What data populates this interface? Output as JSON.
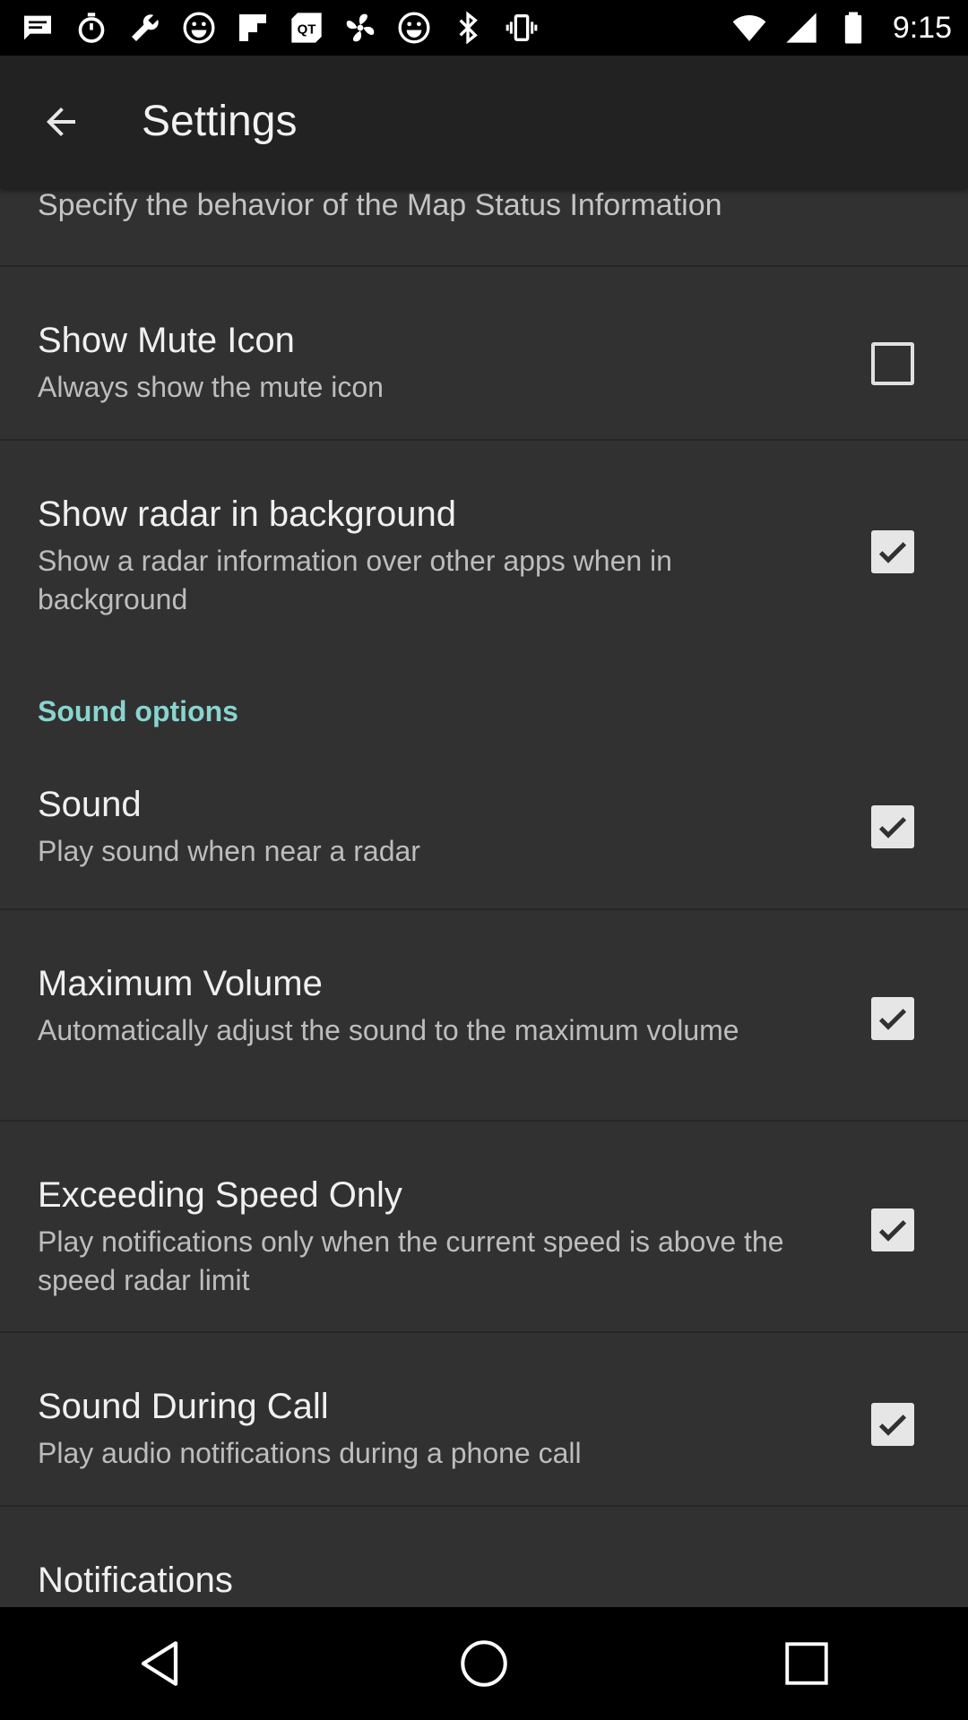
{
  "status_bar": {
    "time": "9:15",
    "left_icons": [
      "message-icon",
      "stopwatch-icon",
      "wrench-icon",
      "smiley-icon",
      "flipboard-icon",
      "qt-icon",
      "fan-icon",
      "smiley-icon",
      "bluetooth-icon",
      "vibrate-icon"
    ],
    "right_icons": [
      "wifi-icon",
      "signal-icon",
      "battery-icon"
    ]
  },
  "app_bar": {
    "title": "Settings",
    "back_icon": "arrow-back-icon"
  },
  "map_status": {
    "summary": "Specify the behavior of the Map Status Information"
  },
  "prefs": [
    {
      "title": "Show Mute Icon",
      "summary": "Always show the mute icon",
      "checked": false
    },
    {
      "title": "Show radar in background",
      "summary": "Show a radar information over other apps when in background",
      "checked": true
    }
  ],
  "sound_options": {
    "header": "Sound options",
    "prefs": [
      {
        "title": "Sound",
        "summary": "Play sound when near a radar",
        "checked": true
      },
      {
        "title": "Maximum Volume",
        "summary": "Automatically adjust the sound to the maximum volume",
        "checked": true
      },
      {
        "title": "Exceeding Speed Only",
        "summary": "Play notifications only when the current speed is above the speed radar limit",
        "checked": true
      },
      {
        "title": "Sound During Call",
        "summary": "Play audio notifications during a phone call",
        "checked": true
      }
    ]
  },
  "notifications": {
    "title": "Notifications"
  },
  "nav_bar": {
    "icons": [
      "back-triangle-icon",
      "home-circle-icon",
      "recents-square-icon"
    ]
  },
  "colors": {
    "accent": "#8ad4cf",
    "background": "#313131",
    "app_bar": "#222222"
  }
}
